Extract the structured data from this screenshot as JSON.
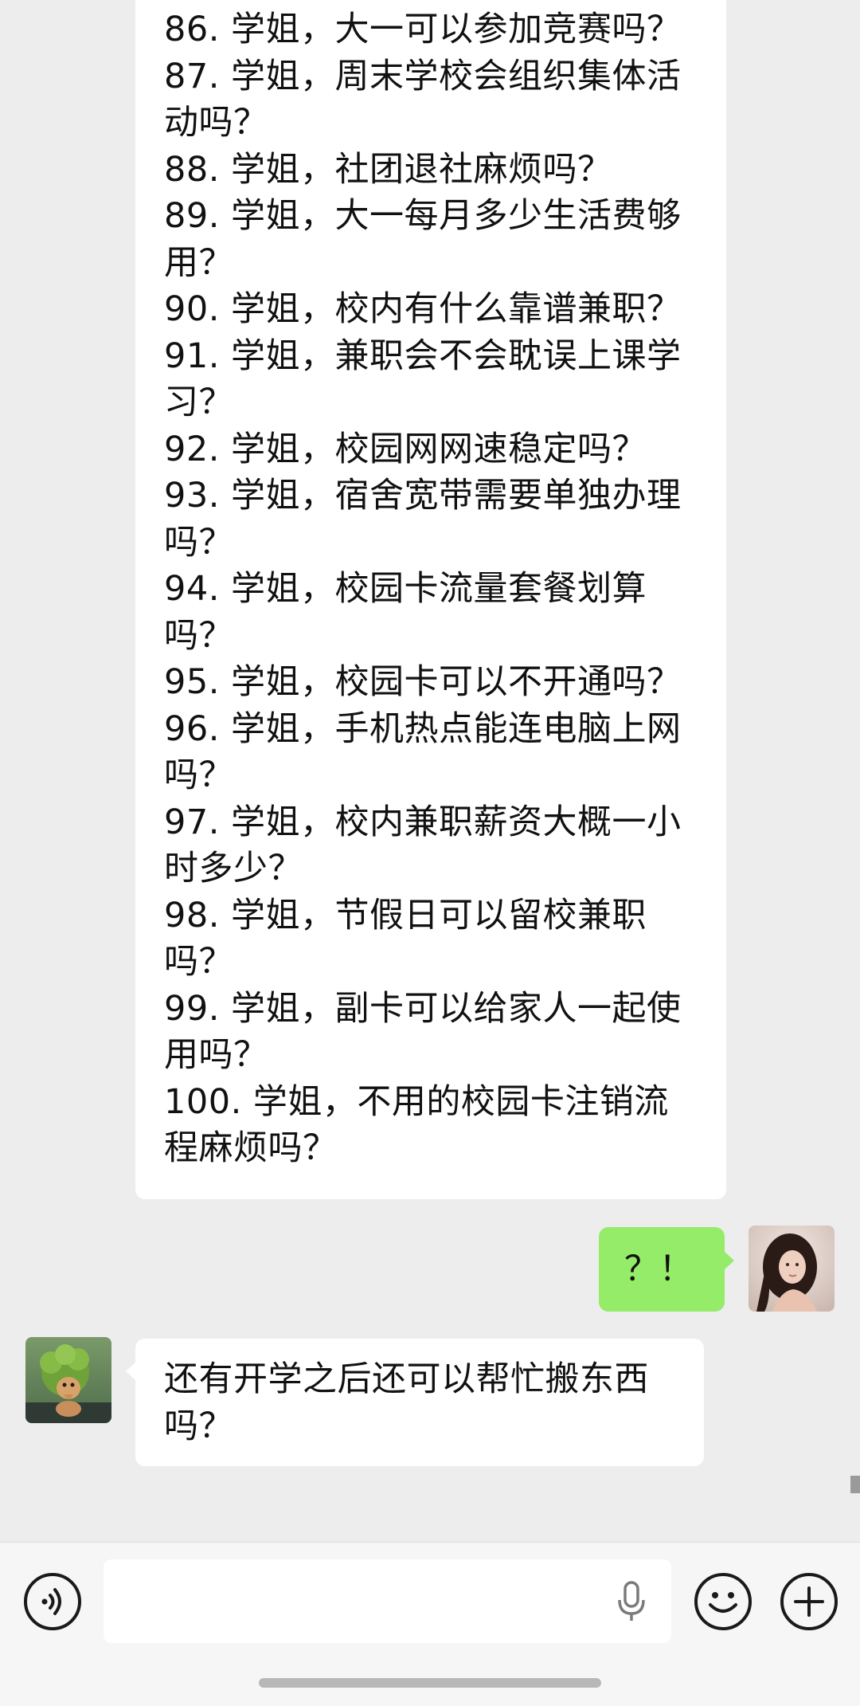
{
  "messages": [
    {
      "side": "left",
      "lines": [
        "86. 学姐，大一可以参加竞赛吗？",
        "87. 学姐，周末学校会组织集体活",
        "动吗？",
        "88. 学姐，社团退社麻烦吗？",
        "89. 学姐，大一每月多少生活费够",
        "用？",
        "90. 学姐，校内有什么靠谱兼职？",
        "91. 学姐，兼职会不会耽误上课学",
        "习？",
        "92. 学姐，校园网网速稳定吗？",
        "93. 学姐，宿舍宽带需要单独办理",
        "吗？",
        "94. 学姐，校园卡流量套餐划算",
        "吗？",
        "95. 学姐，校园卡可以不开通吗？",
        "96. 学姐，手机热点能连电脑上网",
        "吗？",
        "97. 学姐，校内兼职薪资大概一小",
        "时多少？",
        "98. 学姐，节假日可以留校兼职",
        "吗？",
        "99. 学姐，副卡可以给家人一起使",
        "用吗？",
        "100. 学姐，不用的校园卡注销流",
        "程麻烦吗？"
      ]
    },
    {
      "side": "right",
      "text": "？！"
    },
    {
      "side": "left",
      "lines": [
        "还有开学之后还可以帮忙搬东西",
        "吗？"
      ]
    }
  ],
  "colors": {
    "chat_background": "#ededed",
    "incoming_bubble": "#ffffff",
    "outgoing_bubble": "#95ec69",
    "toolbar_background": "#f6f6f6"
  },
  "toolbar": {
    "voice_icon": "voice-icon",
    "mic_icon": "microphone-icon",
    "emoji_icon": "emoji-icon",
    "plus_icon": "plus-icon"
  }
}
